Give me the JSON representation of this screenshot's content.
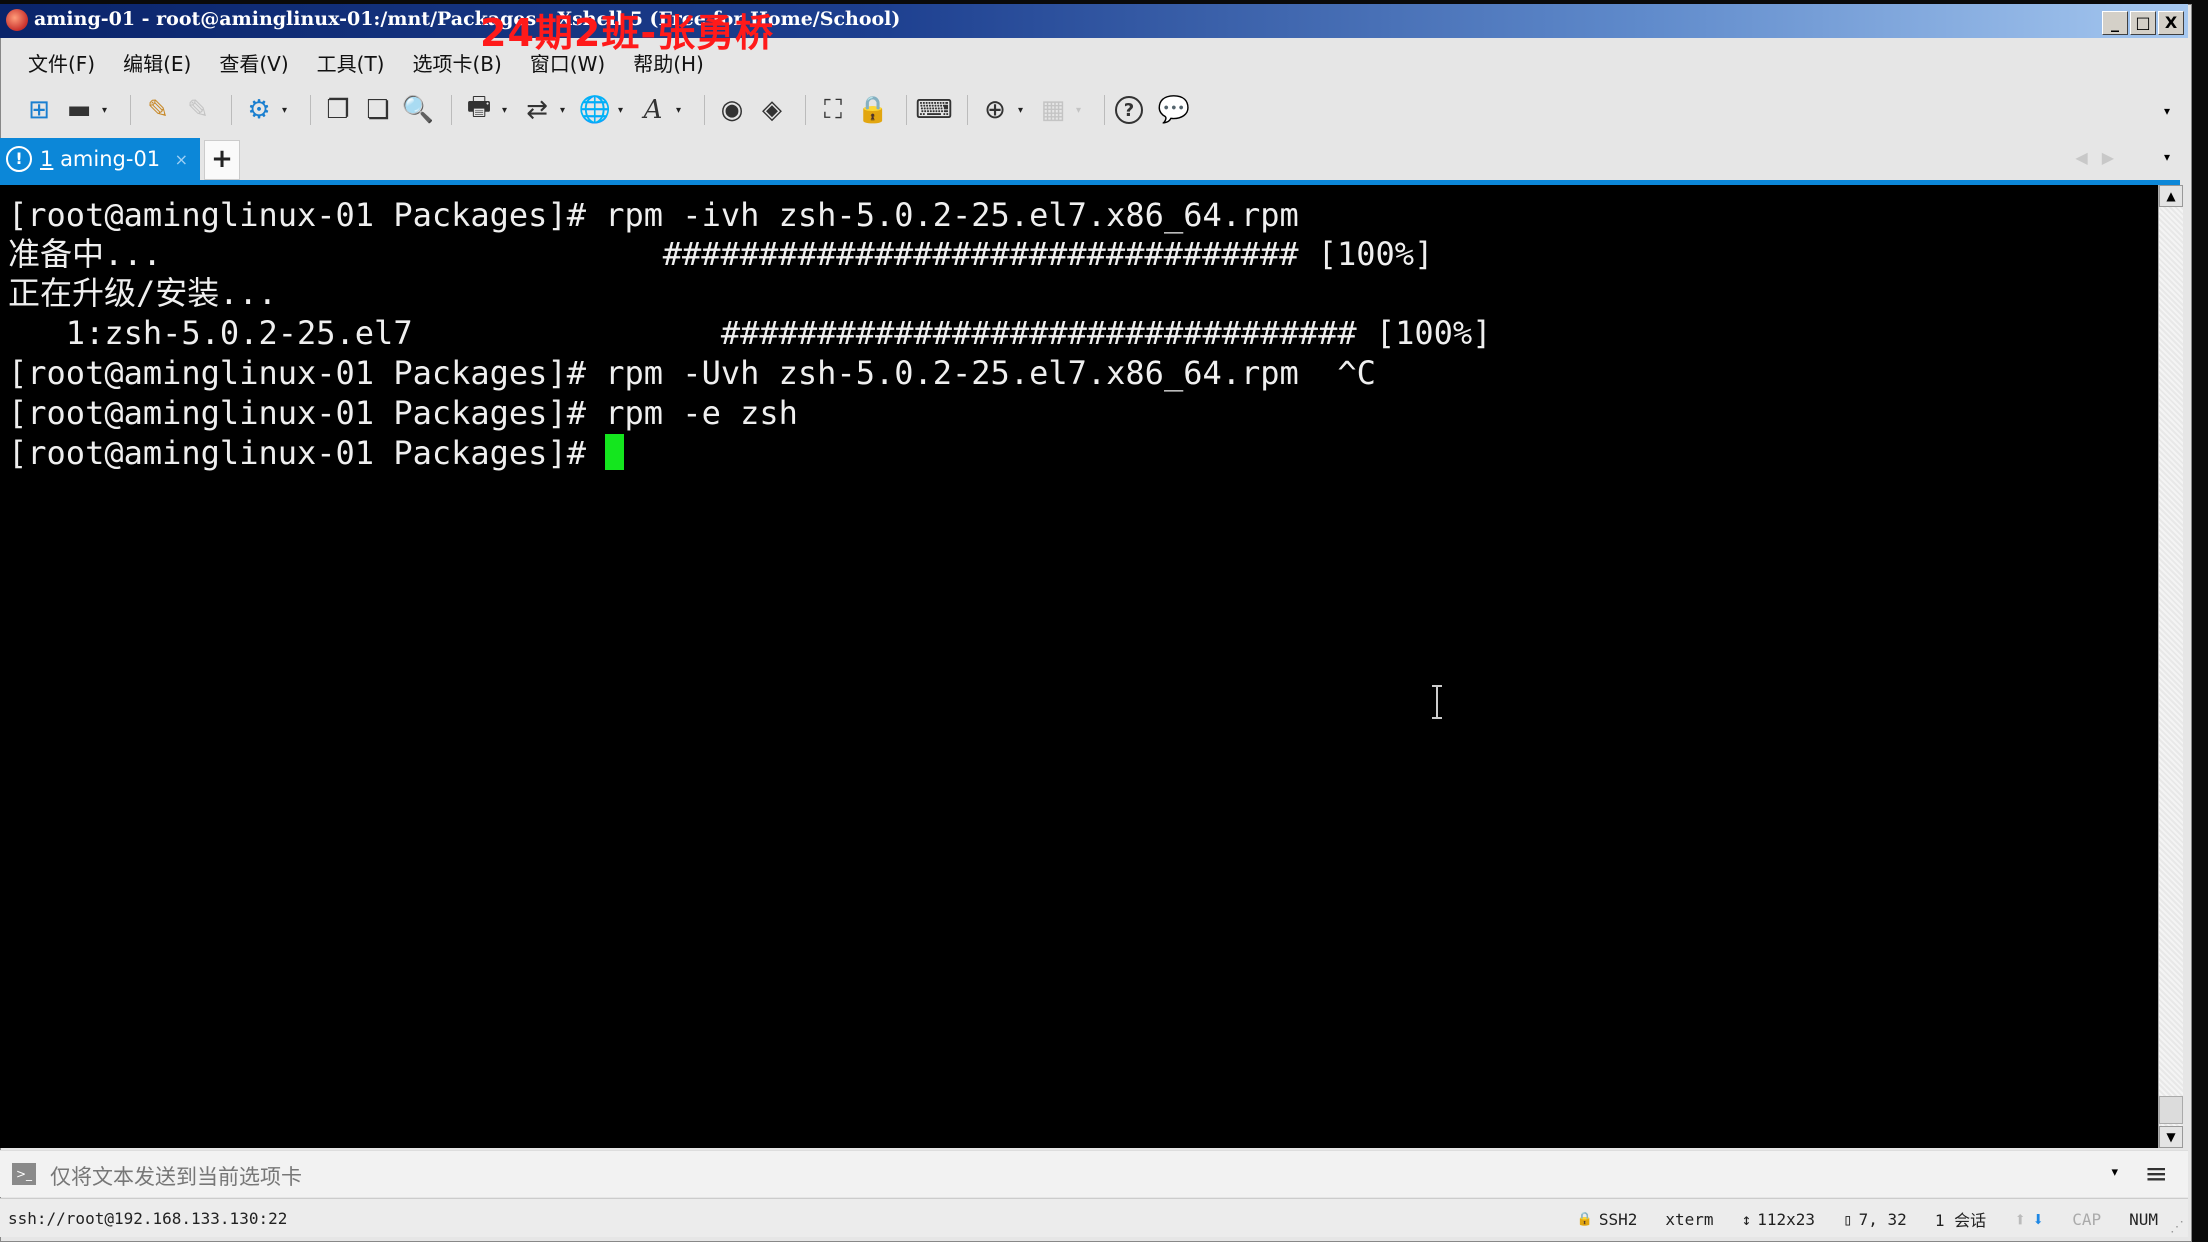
{
  "window": {
    "title": "aming-01 - root@aminglinux-01:/mnt/Packages - Xshell 5 (Free for Home/School)",
    "watermark": "24期2班-张勇桥",
    "controls": {
      "minimize": "_",
      "maximize": "□",
      "close": "X"
    }
  },
  "menu": [
    {
      "label": "文件(F)"
    },
    {
      "label": "编辑(E)"
    },
    {
      "label": "查看(V)"
    },
    {
      "label": "工具(T)"
    },
    {
      "label": "选项卡(B)"
    },
    {
      "label": "窗口(W)"
    },
    {
      "label": "帮助(H)"
    }
  ],
  "toolbar": {
    "icons": {
      "new_session": "⊞",
      "open": "▬",
      "connect": "✎",
      "disconnect": "✎",
      "properties": "⚙",
      "copy": "❐",
      "paste": "❏",
      "find": "🔍",
      "print": "🖶",
      "transfer": "⇄",
      "globe": "🌐",
      "font": "A",
      "xftp": "◉",
      "xmanager": "◈",
      "fullscreen": "⛶",
      "lock": "🔒",
      "keyboard": "⌨",
      "new_tab": "⊕",
      "layout": "▦",
      "help": "?",
      "chat": "💬",
      "dropdown": "▾"
    }
  },
  "tabs": {
    "active": {
      "number": "1",
      "label": "aming-01",
      "alert_icon": "!",
      "close": "×"
    },
    "add_label": "+",
    "nav_prev": "◀",
    "nav_next": "▶",
    "menu": "▾"
  },
  "terminal": {
    "lines": [
      "[root@aminglinux-01 Packages]# rpm -ivh zsh-5.0.2-25.el7.x86_64.rpm",
      "准备中...                          ################################# [100%]",
      "正在升级/安装...",
      "   1:zsh-5.0.2-25.el7                ################################# [100%]",
      "[root@aminglinux-01 Packages]# rpm -Uvh zsh-5.0.2-25.el7.x86_64.rpm  ^C",
      "[root@aminglinux-01 Packages]# rpm -e zsh",
      "[root@aminglinux-01 Packages]# "
    ],
    "cursor_color": "#14e61e"
  },
  "scrollbar": {
    "up": "▲",
    "down": "▼"
  },
  "sendbar": {
    "icon": ">_",
    "text": "仅将文本发送到当前选项卡",
    "dropdown": "▾",
    "menu": "≡"
  },
  "status": {
    "connection": "ssh://root@192.168.133.130:22",
    "protocol": "SSH2",
    "terminal_type": "xterm",
    "size": "112x23",
    "cursor_pos": "7, 32",
    "sessions": "1 会话",
    "upload_arrow": "⬆",
    "download_arrow": "⬇",
    "cap": "CAP",
    "num": "NUM",
    "icons": {
      "lock": "🔒",
      "resize": "↕",
      "cursor": "▯",
      "grip": "⋰"
    }
  },
  "colors": {
    "tab_active": "#0c87d8",
    "terminal_bg": "#000000",
    "terminal_fg": "#efefef",
    "watermark": "#ff1a1a"
  }
}
